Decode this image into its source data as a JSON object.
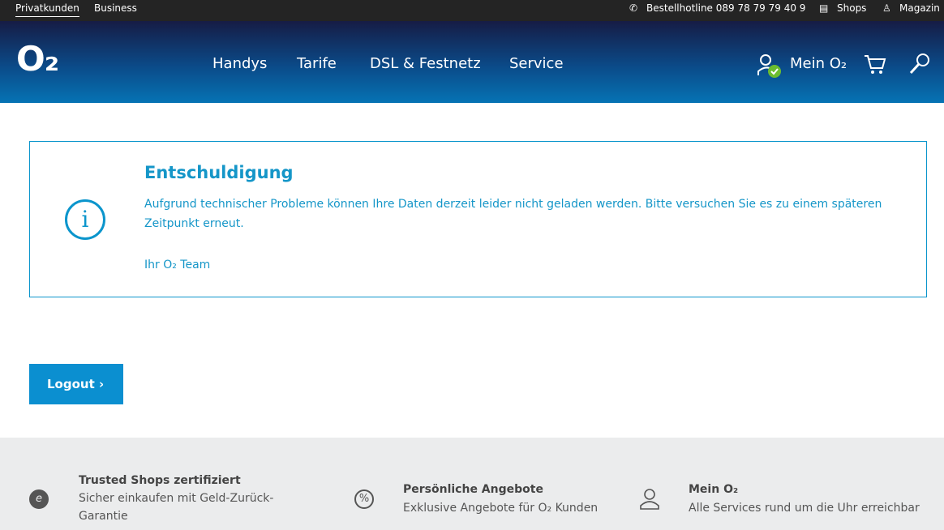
{
  "topbar": {
    "privatkunden": "Privatkunden",
    "business": "Business",
    "hotline": "Bestellhotline 089 78 79 79 40 9",
    "shops": "Shops",
    "magazin": "Magazin"
  },
  "header": {
    "logo": "O₂",
    "nav": [
      "Handys",
      "Tarife",
      "DSL & Festnetz",
      "Service"
    ],
    "mein_o2": "Mein O₂"
  },
  "alert": {
    "title": "Entschuldigung",
    "message": "Aufgrund technischer Probleme können Ihre Daten derzeit leider nicht geladen werden. Bitte versuchen Sie es zu einem späteren Zeitpunkt erneut.",
    "signature": "Ihr O₂ Team"
  },
  "logout_label": "Logout",
  "footer": [
    {
      "title": "Trusted Shops zertifiziert",
      "text": "Sicher einkaufen mit Geld-Zurück-Garantie"
    },
    {
      "title": "Persönliche Angebote",
      "text": "Exklusive Angebote für O₂ Kunden"
    },
    {
      "title": "Mein O₂",
      "text": "Alle Services rund um die Uhr erreichbar"
    }
  ],
  "colors": {
    "accent": "#0b8fd0",
    "check": "#6cbd2f"
  }
}
